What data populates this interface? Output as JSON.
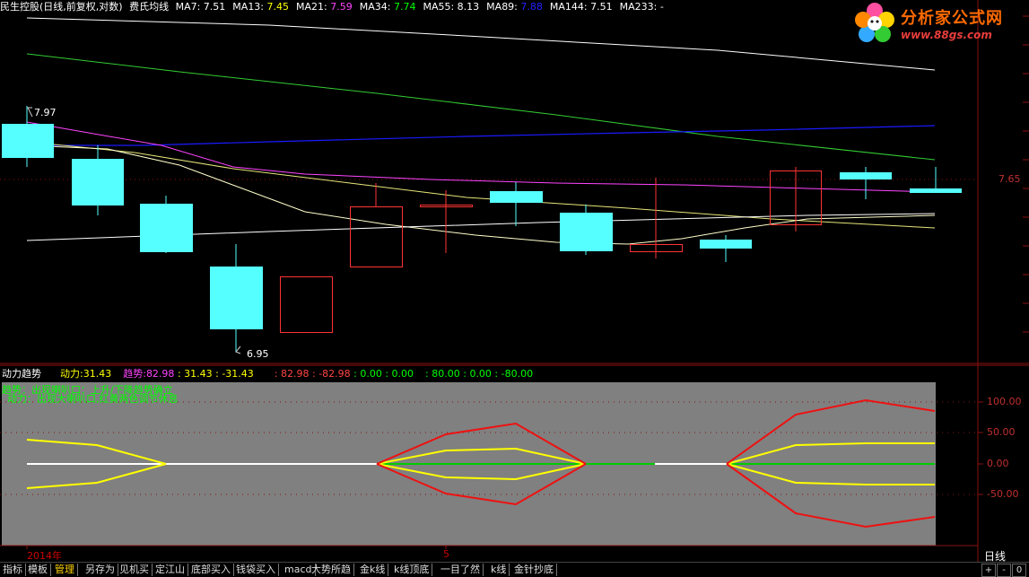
{
  "header": {
    "stock": "民生控股(日线,前复权,对数)",
    "indicator": "费氏均线",
    "ma": [
      {
        "label": "MA7:",
        "value": "7.51",
        "color": "#ffffff"
      },
      {
        "label": "MA13:",
        "value": "7.45",
        "color": "#ffff00"
      },
      {
        "label": "MA21:",
        "value": "7.59",
        "color": "#ff44ff"
      },
      {
        "label": "MA34:",
        "value": "7.74",
        "color": "#00ff00"
      },
      {
        "label": "MA55:",
        "value": "8.13",
        "color": "#ffffff"
      },
      {
        "label": "MA89:",
        "value": "7.88",
        "color": "#2222ff"
      },
      {
        "label": "MA144:",
        "value": "7.51",
        "color": "#ffffff"
      },
      {
        "label": "MA233:",
        "value": "-",
        "color": "#ffffff"
      }
    ]
  },
  "logo": {
    "title": "分析家公式网",
    "url": "www.88gs.com"
  },
  "price_panel": {
    "high_label": "7.97",
    "low_label": "6.95",
    "axis_label": "7.65"
  },
  "indicator_panel": {
    "name": "动力趋势",
    "line1_label": "动力:",
    "line1_value": "31.43",
    "line2_label": "趋势:",
    "line2_value": "82.98",
    "pair1": ": 31.43 : -31.43",
    "pair2": ": 82.98 : -82.98",
    "pair3": ": 0.00 : 0.00",
    "pair4": ": 80.00 : 0.00 : -80.00",
    "note1": "趋势：出现喇叭口：上升/下降趋势确立",
    "note2": "动力：出现大喇叭口,红黄两色调节休息",
    "axis": [
      "100.00",
      "50.00",
      "0.00",
      "-50.00"
    ]
  },
  "chart_data": {
    "type": "line",
    "candles": [
      {
        "o": 7.85,
        "h": 7.97,
        "l": 7.79,
        "c": 7.75,
        "color": "cyan"
      },
      {
        "o": 7.75,
        "h": 7.79,
        "l": 7.52,
        "c": 7.55,
        "color": "cyan"
      },
      {
        "o": 7.51,
        "h": 7.56,
        "l": 7.28,
        "c": 7.3,
        "color": "cyan"
      },
      {
        "o": 7.23,
        "h": 7.31,
        "l": 6.95,
        "c": 6.99,
        "color": "cyan"
      },
      {
        "o": 6.99,
        "h": 7.22,
        "l": 6.99,
        "c": 7.21,
        "color": "red"
      },
      {
        "o": 7.28,
        "h": 7.6,
        "l": 7.26,
        "c": 7.52,
        "color": "red"
      },
      {
        "o": 7.51,
        "h": 7.53,
        "l": 7.35,
        "c": 7.52,
        "color": "red"
      },
      {
        "o": 7.59,
        "h": 7.63,
        "l": 7.47,
        "c": 7.55,
        "color": "cyan"
      },
      {
        "o": 7.49,
        "h": 7.52,
        "l": 7.32,
        "c": 7.34,
        "color": "cyan"
      },
      {
        "o": 7.33,
        "h": 7.65,
        "l": 7.31,
        "c": 7.36,
        "color": "red"
      },
      {
        "o": 7.39,
        "h": 7.4,
        "l": 7.34,
        "c": 7.36,
        "color": "cyan"
      },
      {
        "o": 7.49,
        "h": 7.72,
        "l": 7.46,
        "c": 7.69,
        "color": "red"
      },
      {
        "o": 7.7,
        "h": 7.72,
        "l": 7.59,
        "c": 7.67,
        "color": "cyan"
      },
      {
        "o": 7.63,
        "h": 7.7,
        "l": 7.62,
        "c": 7.61,
        "color": "cyan"
      }
    ],
    "indicator": {
      "red_upper": [
        null,
        null,
        null,
        null,
        null,
        null,
        40,
        60,
        0,
        null,
        null,
        null,
        null,
        null,
        null,
        75,
        100,
        80
      ],
      "x_count": 14
    }
  },
  "tabs": [
    "指标",
    "模板",
    "管理",
    "另存为",
    "见机买",
    "定江山",
    "底部买入",
    "钱袋买入",
    "macd",
    "大势所趋",
    "金k线",
    "k线顶底",
    "一目了然",
    "k线",
    "金针抄底"
  ],
  "active_tab": "管理",
  "bottom": {
    "year": "2014年",
    "mark": "5",
    "period": "日线",
    "plus": "+",
    "minus": "-",
    "zero": "0"
  }
}
